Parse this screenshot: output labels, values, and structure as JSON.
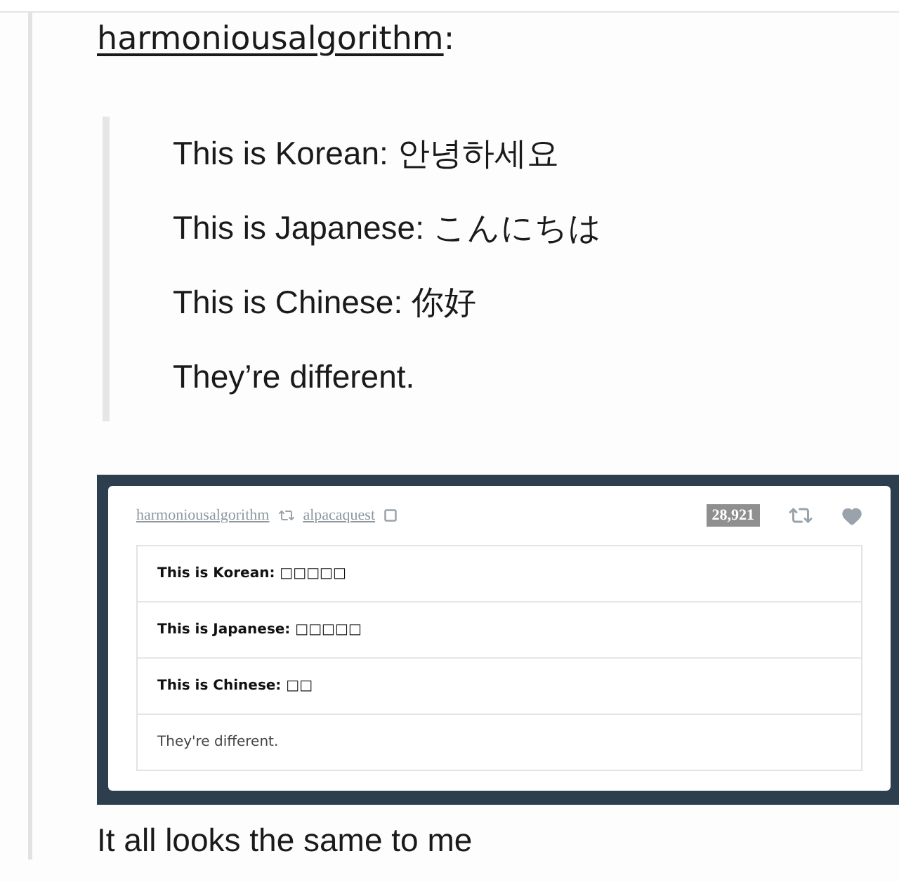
{
  "post": {
    "author": "harmoniousalgorithm",
    "separator": ":",
    "quote_lines": [
      "This is Korean: 안녕하세요",
      "This is Japanese: こんにちは",
      "This is Chinese: 你好",
      "They’re different."
    ]
  },
  "embedded_post": {
    "author": "harmoniousalgorithm",
    "reblogged_from": "alpacaquest",
    "notes": "28,921",
    "lines": [
      {
        "text": "This is Korean:",
        "glyphs": "□□□□□",
        "bold": true
      },
      {
        "text": "This is Japanese:",
        "glyphs": "□□□□□",
        "bold": true
      },
      {
        "text": "This is Chinese:",
        "glyphs": "□□",
        "bold": true
      },
      {
        "text": "They're different.",
        "bold": false
      }
    ]
  },
  "caption": "It all looks the same to me"
}
